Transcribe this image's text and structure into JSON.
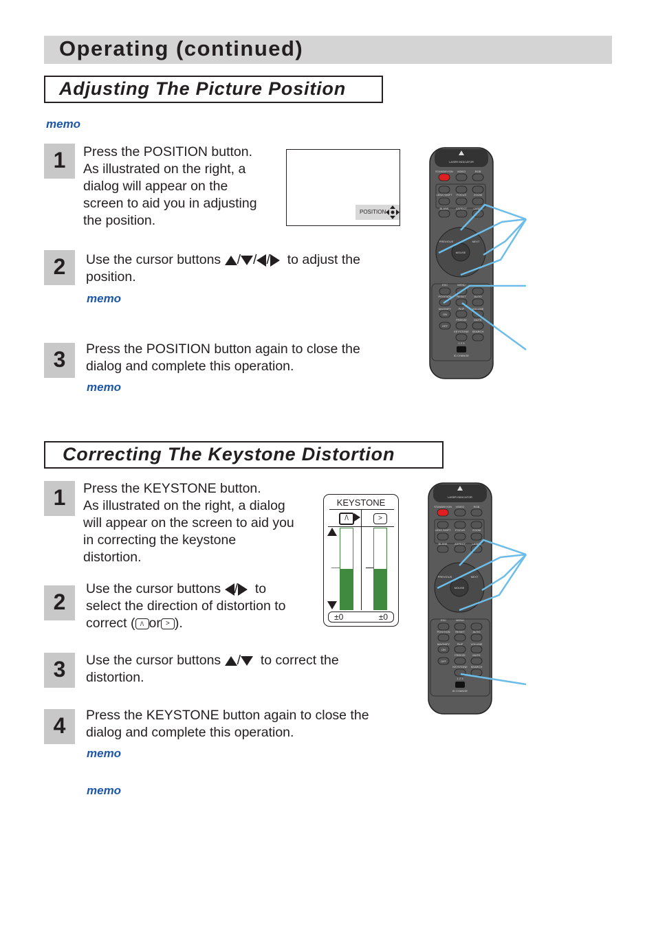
{
  "page_title": "Operating (continued)",
  "section1": {
    "heading": "Adjusting The Picture Position",
    "memo_top": "memo",
    "steps": [
      {
        "number": "1",
        "lines": [
          "Press the POSITION button.",
          "As illustrated on the right, a",
          "dialog will appear on the",
          "screen to aid you in adjusting",
          "the position."
        ]
      },
      {
        "number": "2",
        "before": "Use the cursor buttons",
        "after": "to adjust the",
        "line2": "position.",
        "memo": "memo"
      },
      {
        "number": "3",
        "lines": [
          "Press the POSITION button again to close the",
          "dialog and complete this operation."
        ],
        "memo": "memo"
      }
    ],
    "dialog_label": "POSITION"
  },
  "section2": {
    "heading": "Correcting The Keystone Distortion",
    "steps": [
      {
        "number": "1",
        "lines": [
          "Press the KEYSTONE button.",
          "As illustrated on the right, a dialog",
          "will appear on the screen to aid you",
          "in correcting the keystone",
          "distortion."
        ]
      },
      {
        "number": "2",
        "before": "Use the cursor buttons",
        "after": "to",
        "line2": "select the direction of distortion to",
        "line3_a": "correct (",
        "line3_or": "or",
        "line3_b": ")."
      },
      {
        "number": "3",
        "before": "Use the cursor buttons",
        "after": "to correct the",
        "line2": "distortion."
      },
      {
        "number": "4",
        "lines": [
          "Press the KEYSTONE button again to close the",
          "dialog and complete this operation."
        ],
        "memo": "memo"
      }
    ],
    "memo_bottom": "memo",
    "keystone_dialog": {
      "title": "KEYSTONE",
      "left_value": "±0",
      "right_value": "±0",
      "left_level": 0.5,
      "right_level": 0.5,
      "bar_color": "#3f8a3f"
    }
  },
  "slash": "/",
  "remote": {
    "laser_indicator": "LASER INDICATOR",
    "standby": "STANDBY/ON",
    "video": "VIDEO",
    "rgb": "RGB",
    "lens_shift": "LENS SHIFT",
    "focus": "FOCUS",
    "zoom": "ZOOM",
    "blank": "BLANK",
    "aspect": "ASPECT",
    "laser": "LASER",
    "previous": "PREVIOUS",
    "next": "NEXT",
    "mouse": "MOUSE",
    "esc": "ESC",
    "menu": "MENU",
    "position": "POSITION",
    "reset": "RESET",
    "auto": "AUTO",
    "magnify": "MAGNIFY",
    "on": "ON",
    "pip": "PinP",
    "volume": "VOLUME",
    "off": "OFF",
    "freeze": "FREEZE",
    "mute": "MUTE",
    "keystone": "KEYSTONE",
    "search": "SEARCH",
    "id_nums": "1 2 3",
    "id_change": "ID CHANGE",
    "callout_color": "#6cbde9",
    "body_color": "#5a5a5a",
    "standby_color": "#e02020"
  }
}
